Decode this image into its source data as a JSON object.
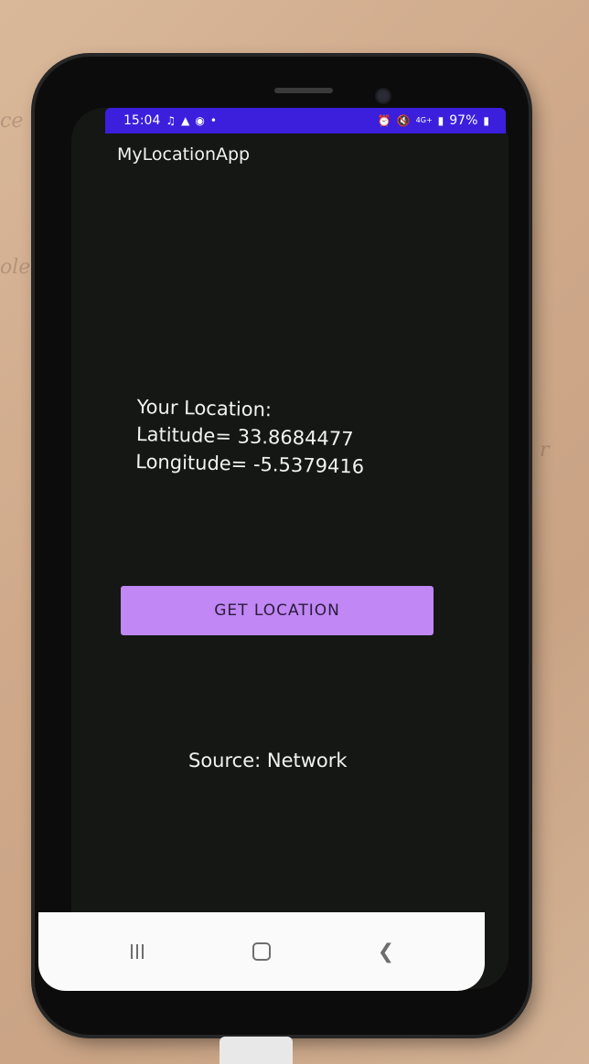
{
  "status_bar": {
    "time": "15:04",
    "battery": "97%",
    "icons_left": [
      "notification-icon",
      "notification-icon",
      "instagram-icon",
      "dot-icon"
    ],
    "icons_right": [
      "alarm-icon",
      "mute-icon",
      "network-4g-icon",
      "signal-icon",
      "battery-icon"
    ],
    "network_label": "4G+",
    "color": "#3b1fdc"
  },
  "app": {
    "title": "MyLocationApp"
  },
  "location": {
    "heading": "Your Location:",
    "latitude_line": "Latitude= 33.8684477",
    "longitude_line": "Longitude= -5.5379416"
  },
  "actions": {
    "get_location_label": "GET LOCATION",
    "button_color": "#c087f5"
  },
  "source": {
    "text": "Source: Network"
  },
  "navigation": {
    "items": [
      "recents-icon",
      "home-icon",
      "back-icon"
    ]
  }
}
